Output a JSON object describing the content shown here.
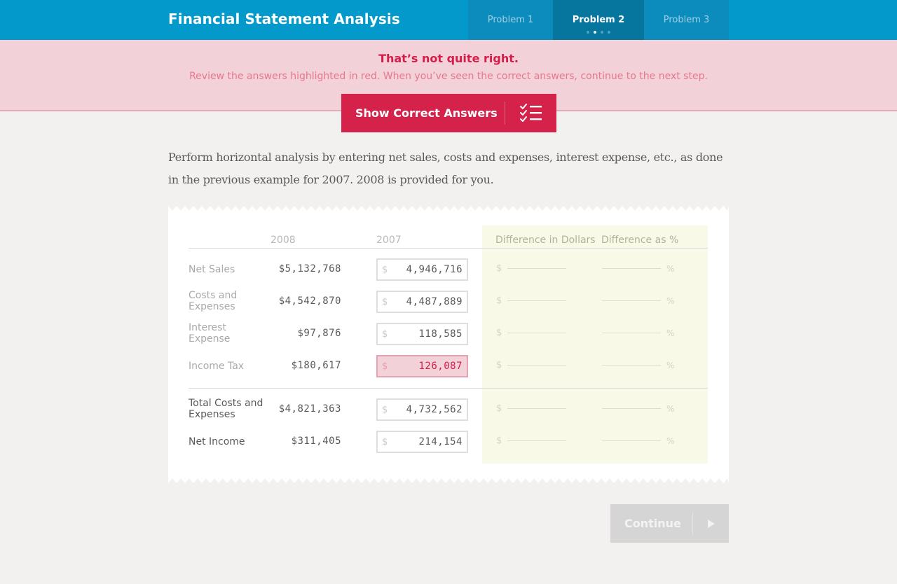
{
  "header": {
    "title": "Financial Statement Analysis",
    "tabs": [
      {
        "label": "Problem 1",
        "active": false
      },
      {
        "label": "Problem 2",
        "active": true
      },
      {
        "label": "Problem 3",
        "active": false
      }
    ]
  },
  "feedback": {
    "title": "That’s not quite right.",
    "message": "Review the answers highlighted in red. When you’ve seen the correct answers, continue to the next step.",
    "button_label": "Show Correct Answers"
  },
  "instructions": "Perform horizontal analysis by entering net sales, costs and expenses, interest expense, etc., as done in the previous example for 2007. 2008 is provided for you.",
  "table": {
    "headers": {
      "col_2008": "2008",
      "col_2007": "2007",
      "diff_dollars": "Difference in Dollars",
      "diff_percent": "Difference as %"
    },
    "currency_symbol": "$",
    "percent_symbol": "%",
    "rows": [
      {
        "label": "Net Sales",
        "v2008": "$5,132,768",
        "v2007": "4,946,716",
        "wrong": false
      },
      {
        "label": "Costs and Expenses",
        "v2008": "$4,542,870",
        "v2007": "4,487,889",
        "wrong": false
      },
      {
        "label": "Interest Expense",
        "v2008": "$97,876",
        "v2007": "118,585",
        "wrong": false
      },
      {
        "label": "Income Tax",
        "v2008": "$180,617",
        "v2007": "126,087",
        "wrong": true
      }
    ],
    "totals": [
      {
        "label": "Total Costs and Expenses",
        "v2008": "$4,821,363",
        "v2007": "4,732,562"
      },
      {
        "label": "Net Income",
        "v2008": "$311,405",
        "v2007": "214,154"
      }
    ]
  },
  "continue_label": "Continue",
  "colors": {
    "header": "#0399cb",
    "accent_red": "#d4224a",
    "banner_bg": "#f2d2d8",
    "diff_bg": "#f8fae7"
  },
  "icons": {
    "checklist": "checklist-icon",
    "play": "play-arrow-icon"
  }
}
